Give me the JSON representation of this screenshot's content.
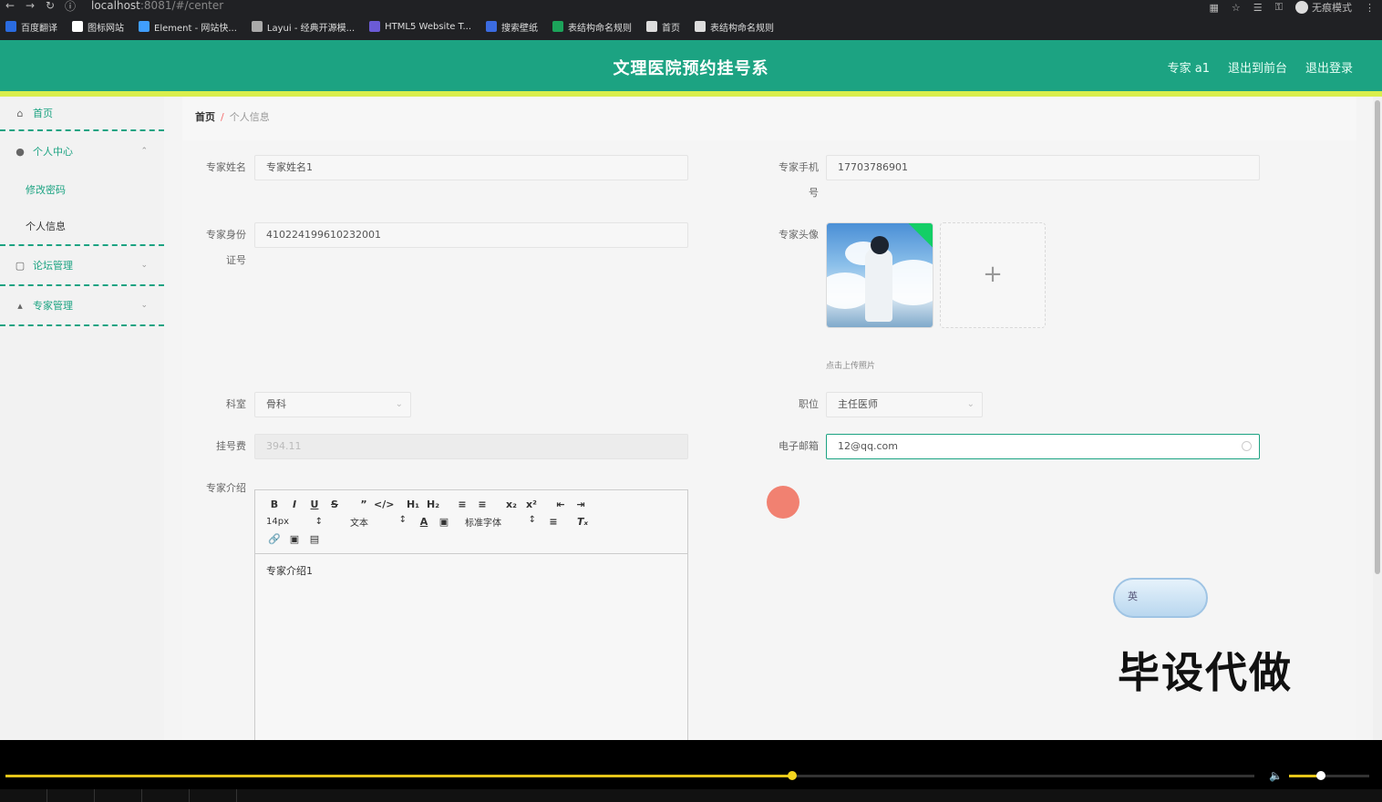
{
  "browser": {
    "url_host": "localhost",
    "url_rest": ":8081/#/center",
    "incognito_label": "无痕模式",
    "bookmarks": [
      {
        "label": "百度翻译",
        "color": "#2a6be0"
      },
      {
        "label": "图标网站",
        "color": "#ffffff"
      },
      {
        "label": "Element - 网站快...",
        "color": "#409eff"
      },
      {
        "label": "Layui - 经典开源模...",
        "color": "#aaaaaa"
      },
      {
        "label": "HTML5 Website T...",
        "color": "#6b5bd6"
      },
      {
        "label": "搜索壁纸",
        "color": "#3b6be0"
      },
      {
        "label": "表结构命名规则",
        "color": "#1ca35a"
      },
      {
        "label": "首页",
        "color": "#dddddd"
      },
      {
        "label": "表结构命名规则",
        "color": "#dddddd"
      }
    ]
  },
  "header": {
    "title": "文理医院预约挂号系",
    "user": "专家 a1",
    "to_front": "退出到前台",
    "logout": "退出登录"
  },
  "sidebar": {
    "home": "首页",
    "personal_center": "个人中心",
    "change_password": "修改密码",
    "personal_info": "个人信息",
    "forum_management": "论坛管理",
    "expert_management": "专家管理"
  },
  "breadcrumb": {
    "home": "首页",
    "separator": "/",
    "current": "个人信息"
  },
  "form": {
    "name_label": "专家姓名",
    "name_value": "专家姓名1",
    "phone_label_1": "专家手机",
    "phone_label_2": "号",
    "phone_value": "17703786901",
    "idcard_label_1": "专家身份",
    "idcard_label_2": "证号",
    "idcard_value": "410224199610232001",
    "avatar_label": "专家头像",
    "upload_plus": "+",
    "upload_hint": "点击上传照片",
    "dept_label": "科室",
    "dept_value": "骨科",
    "title_label": "职位",
    "title_value": "主任医师",
    "fee_label": "挂号费",
    "fee_value": "394.11",
    "email_label": "电子邮箱",
    "email_value": "12@qq.com",
    "intro_label": "专家介绍",
    "intro_value": "专家介绍1"
  },
  "editor_toolbar": {
    "font_size": "14px",
    "paragraph": "文本",
    "font_family": "标准字体"
  },
  "overlay": {
    "ime_label": "英",
    "watermark": "毕设代做"
  },
  "player": {
    "progress": 0.63,
    "volume": 0.4,
    "accent": "#e6c619"
  },
  "colors": {
    "brand": "#1ca382",
    "accent_bar": "#d9ee4c"
  }
}
